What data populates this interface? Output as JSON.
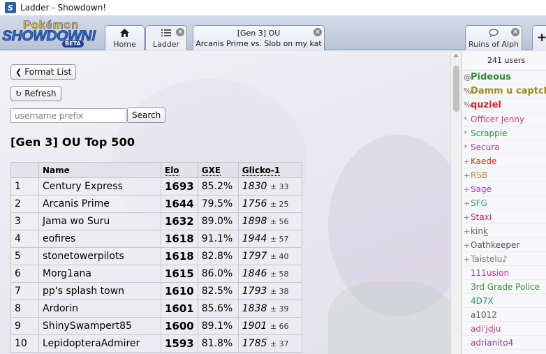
{
  "window": {
    "title": "Ladder - Showdown!",
    "icon": "showdown-app-icon"
  },
  "logo": {
    "line1": "Pokémon",
    "line2": "SHOWDOWN!",
    "line3": "BETA"
  },
  "tabs": [
    {
      "label": "Home",
      "icon": "home-icon"
    },
    {
      "label": "Ladder",
      "icon": "list-icon",
      "close": "×"
    },
    {
      "line1": "[Gen 3] OU",
      "line2": "Arcanis Prime vs. Slob on my kat",
      "close": "×"
    },
    {
      "label": "Ruins of Alph",
      "icon": "chat-bubble-icon",
      "close": "×"
    }
  ],
  "plus_label": "+",
  "buttons": {
    "format_list": "Format List",
    "refresh": "Refresh",
    "search": "Search"
  },
  "search": {
    "placeholder": "username prefix",
    "value": ""
  },
  "ladder": {
    "title": "[Gen 3] OU Top 500",
    "headers": [
      "",
      "Name",
      "Elo",
      "GXE",
      "Glicko-1"
    ],
    "rows": [
      {
        "rank": "1",
        "name": "Century Express",
        "elo": "1693",
        "gxe": "85.2%",
        "glicko": "1830",
        "dev": "± 33"
      },
      {
        "rank": "2",
        "name": "Arcanis Prime",
        "elo": "1644",
        "gxe": "79.5%",
        "glicko": "1756",
        "dev": "± 25"
      },
      {
        "rank": "3",
        "name": "Jama wo Suru",
        "elo": "1632",
        "gxe": "89.0%",
        "glicko": "1898",
        "dev": "± 56"
      },
      {
        "rank": "4",
        "name": "eofires",
        "elo": "1618",
        "gxe": "91.1%",
        "glicko": "1944",
        "dev": "± 57"
      },
      {
        "rank": "5",
        "name": "stonetowerpilots",
        "elo": "1618",
        "gxe": "82.8%",
        "glicko": "1797",
        "dev": "± 40"
      },
      {
        "rank": "6",
        "name": "Morg1ana",
        "elo": "1615",
        "gxe": "86.0%",
        "glicko": "1846",
        "dev": "± 58"
      },
      {
        "rank": "7",
        "name": "pp's splash town",
        "elo": "1610",
        "gxe": "82.5%",
        "glicko": "1793",
        "dev": "± 38"
      },
      {
        "rank": "8",
        "name": "Ardorin",
        "elo": "1601",
        "gxe": "85.6%",
        "glicko": "1838",
        "dev": "± 39"
      },
      {
        "rank": "9",
        "name": "ShinySwampert85",
        "elo": "1600",
        "gxe": "89.1%",
        "glicko": "1901",
        "dev": "± 66"
      },
      {
        "rank": "10",
        "name": "LepidopteraAdmirer",
        "elo": "1593",
        "gxe": "81.8%",
        "glicko": "1785",
        "dev": "± 37"
      }
    ]
  },
  "userlist": {
    "count": "241 users",
    "users": [
      {
        "group": "@",
        "name": "Pideous",
        "color": "#2f8a3a",
        "bold": true
      },
      {
        "group": "%",
        "name": "Damm u captcha",
        "color": "#9b8b1d",
        "bold": true
      },
      {
        "group": "%",
        "name": "quziel",
        "color": "#d0262a",
        "bold": true
      },
      {
        "group": "*",
        "name": "Officer Jenny",
        "color": "#c9386d",
        "bold": false
      },
      {
        "group": "*",
        "name": "Scrappie",
        "color": "#2d8a3e",
        "bold": false
      },
      {
        "group": "*",
        "name": "Secura",
        "color": "#a03a8f",
        "bold": false
      },
      {
        "group": "+",
        "name": "Kaede",
        "color": "#b5381d",
        "bold": false
      },
      {
        "group": "+",
        "name": "RSB",
        "color": "#b8862c",
        "bold": false
      },
      {
        "group": "+",
        "name": "Sage",
        "color": "#9a3fa8",
        "bold": false
      },
      {
        "group": "+",
        "name": "SFG",
        "color": "#2f9a6a",
        "bold": false
      },
      {
        "group": "+",
        "name": "Staxi",
        "color": "#b82a66",
        "bold": false
      },
      {
        "group": "+",
        "name": "kink̲",
        "color": "#666666",
        "bold": false
      },
      {
        "group": "+",
        "name": "Oathkeeper",
        "color": "#555555",
        "bold": false
      },
      {
        "group": "+",
        "name": "Taistelu♪",
        "color": "#777777",
        "bold": false
      },
      {
        "group": " ",
        "name": "111usion",
        "color": "#b8399a",
        "bold": false
      },
      {
        "group": " ",
        "name": "3rd Grade Police",
        "color": "#3a8f3a",
        "bold": false
      },
      {
        "group": " ",
        "name": "4D7X",
        "color": "#2f8a6a",
        "bold": false
      },
      {
        "group": " ",
        "name": "a1012",
        "color": "#555555",
        "bold": false
      },
      {
        "group": " ",
        "name": "adi'jdju",
        "color": "#b8337f",
        "bold": false
      },
      {
        "group": " ",
        "name": "adrianito4",
        "color": "#8a3a8a",
        "bold": false
      }
    ]
  }
}
